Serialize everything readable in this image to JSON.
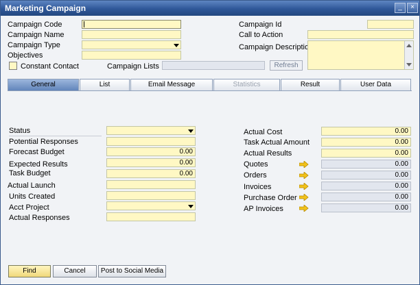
{
  "window": {
    "title": "Marketing Campaign",
    "minimize_glyph": "_",
    "close_glyph": "×"
  },
  "header": {
    "campaign_code_label": "Campaign Code",
    "campaign_name_label": "Campaign Name",
    "campaign_type_label": "Campaign Type",
    "objectives_label": "Objectives",
    "constant_contact_label": "Constant Contact",
    "campaign_lists_label": "Campaign Lists",
    "refresh_label": "Refresh",
    "campaign_id_label": "Campaign Id",
    "call_to_action_label": "Call to Action",
    "campaign_description_label": "Campaign Description"
  },
  "tabs": [
    {
      "label": "General"
    },
    {
      "label": "List"
    },
    {
      "label": "Email Message"
    },
    {
      "label": "Statistics"
    },
    {
      "label": "Result"
    },
    {
      "label": "User Data"
    }
  ],
  "general": {
    "status_label": "Status",
    "potential_responses_label": "Potential Responses",
    "forecast_budget_label": "Forecast Budget",
    "forecast_budget_value": "0.00",
    "expected_results_label": "Expected Results",
    "expected_results_value": "0.00",
    "task_budget_label": "Task Budget",
    "task_budget_value": "0.00",
    "actual_launch_label": "Actual Launch",
    "units_created_label": "Units Created",
    "acct_project_label": "Acct Project",
    "actual_responses_label": "Actual Responses",
    "actual_cost_label": "Actual Cost",
    "actual_cost_value": "0.00",
    "task_actual_amount_label": "Task Actual Amount",
    "task_actual_amount_value": "0.00",
    "actual_results_label": "Actual Results",
    "actual_results_value": "0.00",
    "quotes_label": "Quotes",
    "quotes_value": "0.00",
    "orders_label": "Orders",
    "orders_value": "0.00",
    "invoices_label": "Invoices",
    "invoices_value": "0.00",
    "purchase_order_label": "Purchase Order",
    "purchase_order_value": "0.00",
    "ap_invoices_label": "AP Invoices",
    "ap_invoices_value": "0.00"
  },
  "footer": {
    "find_label": "Find",
    "cancel_label": "Cancel",
    "post_label": "Post to Social Media"
  },
  "colors": {
    "field": "#fff8c4",
    "readonly": "#e2e6ee",
    "titlebar": "#2f5798",
    "link_arrow": "#f2c21b"
  },
  "icons": [
    "minimize-icon",
    "close-icon",
    "dropdown-icon",
    "link-arrow-icon"
  ]
}
